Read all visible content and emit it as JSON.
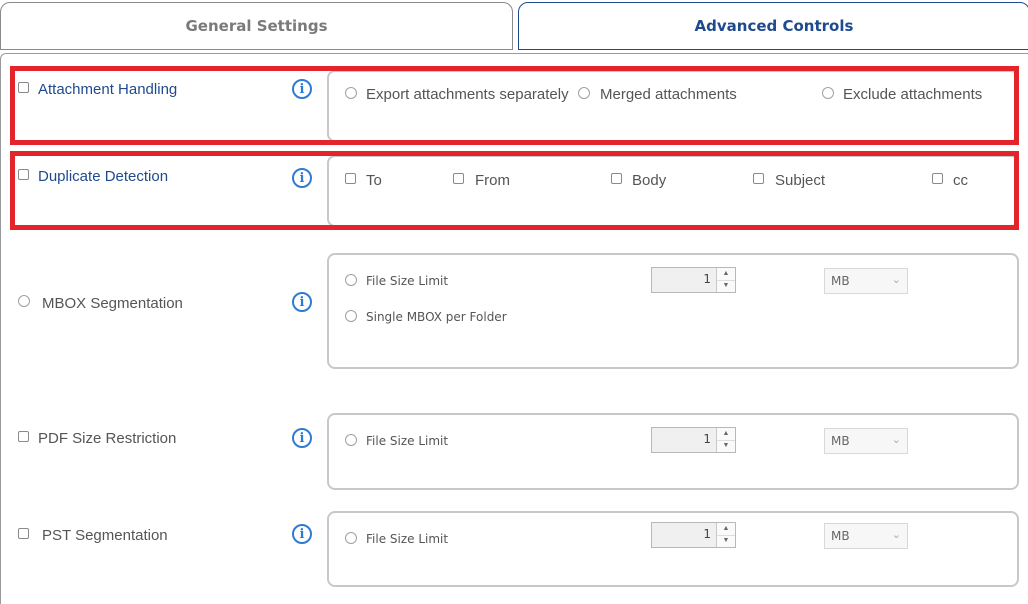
{
  "tabs": {
    "general": "General Settings",
    "advanced": "Advanced Controls"
  },
  "attachment": {
    "label": "Attachment Handling",
    "options": [
      "Export attachments separately",
      "Merged attachments",
      "Exclude attachments"
    ]
  },
  "duplicate": {
    "label": "Duplicate Detection",
    "options": [
      "To",
      "From",
      "Body",
      "Subject",
      "cc"
    ]
  },
  "mbox": {
    "label": "MBOX Segmentation",
    "opt_file_size": "File Size Limit",
    "opt_single": "Single MBOX per Folder",
    "value": "1",
    "unit": "MB"
  },
  "pdf": {
    "label": "PDF Size Restriction",
    "opt_file_size": "File Size Limit",
    "value": "1",
    "unit": "MB"
  },
  "pst": {
    "label": "PST Segmentation",
    "opt_file_size": "File Size Limit",
    "value": "1",
    "unit": "MB"
  },
  "icons": {
    "info": "i",
    "chevron": "⌄",
    "spin_up": "▲",
    "spin_down": "▼"
  },
  "colors": {
    "accent_blue": "#1f4b8e",
    "highlight_red": "#e3242b",
    "info_blue": "#2f7bd4"
  }
}
